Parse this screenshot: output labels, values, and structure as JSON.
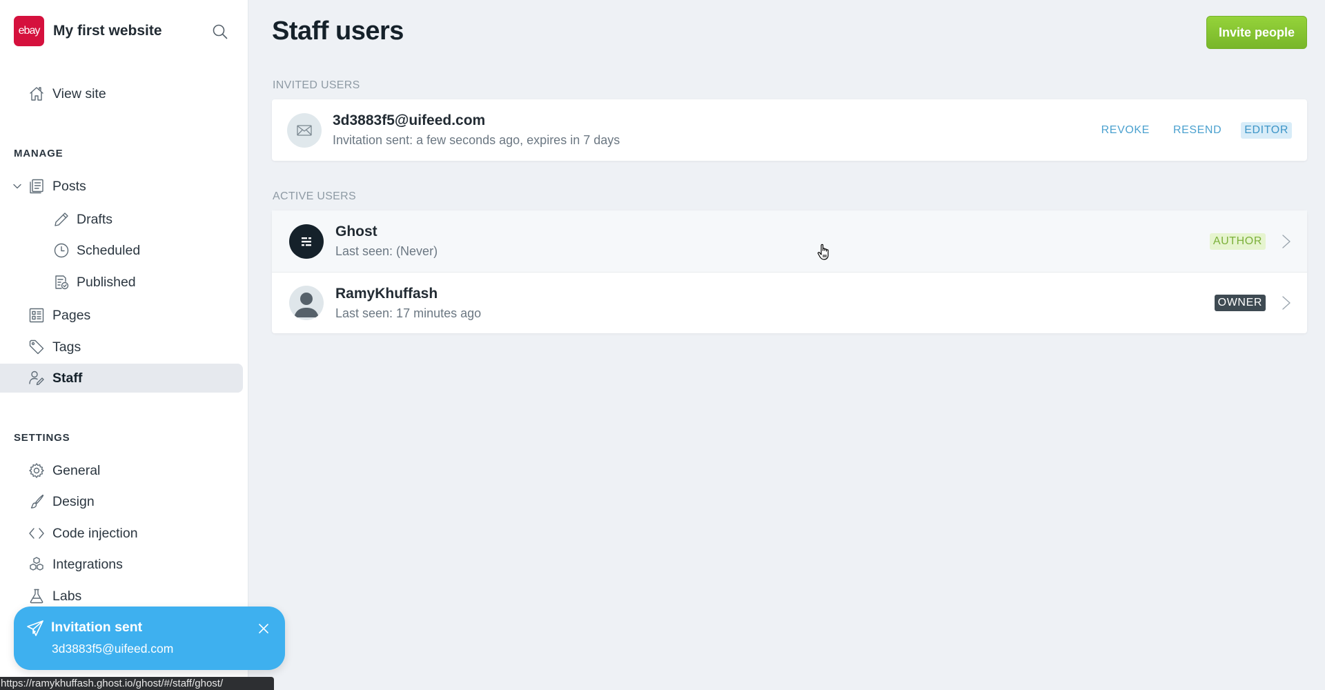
{
  "sidebar": {
    "site_title": "My first website",
    "logo_text": "ebay",
    "logo_color": "#d5113d",
    "view_site": "View site",
    "manage_title": "MANAGE",
    "manage_items": [
      {
        "label": "Posts",
        "icon": "posts-icon"
      },
      {
        "label": "Drafts",
        "icon": "pencil-icon"
      },
      {
        "label": "Scheduled",
        "icon": "clock-icon"
      },
      {
        "label": "Published",
        "icon": "published-icon"
      },
      {
        "label": "Pages",
        "icon": "pages-icon"
      },
      {
        "label": "Tags",
        "icon": "tag-icon"
      },
      {
        "label": "Staff",
        "icon": "staff-icon",
        "active": true
      }
    ],
    "settings_title": "SETTINGS",
    "settings_items": [
      {
        "label": "General",
        "icon": "gear-icon"
      },
      {
        "label": "Design",
        "icon": "brush-icon"
      },
      {
        "label": "Code injection",
        "icon": "code-icon"
      },
      {
        "label": "Integrations",
        "icon": "cubes-icon"
      },
      {
        "label": "Labs",
        "icon": "flask-icon"
      }
    ]
  },
  "main": {
    "title": "Staff users",
    "invite_button": "Invite people",
    "invite_button_color": "#86c530",
    "invited_label": "Invited users",
    "invited": [
      {
        "email": "3d3883f5@uifeed.com",
        "status": "Invitation sent: a few seconds ago, expires in 7 days",
        "revoke": "Revoke",
        "resend": "Resend",
        "role": "Editor"
      }
    ],
    "active_label": "Active users",
    "active": [
      {
        "name": "Ghost",
        "last_seen": "Last seen: (Never)",
        "role": "Author"
      },
      {
        "name": "RamyKhuffash",
        "last_seen": "Last seen: 17 minutes ago",
        "role": "Owner"
      }
    ]
  },
  "toast": {
    "title": "Invitation sent",
    "message": "3d3883f5@uifeed.com",
    "color": "#3eb0ef"
  },
  "status_bar": {
    "url": "https://ramykhuffash.ghost.io/ghost/#/staff/ghost/"
  }
}
